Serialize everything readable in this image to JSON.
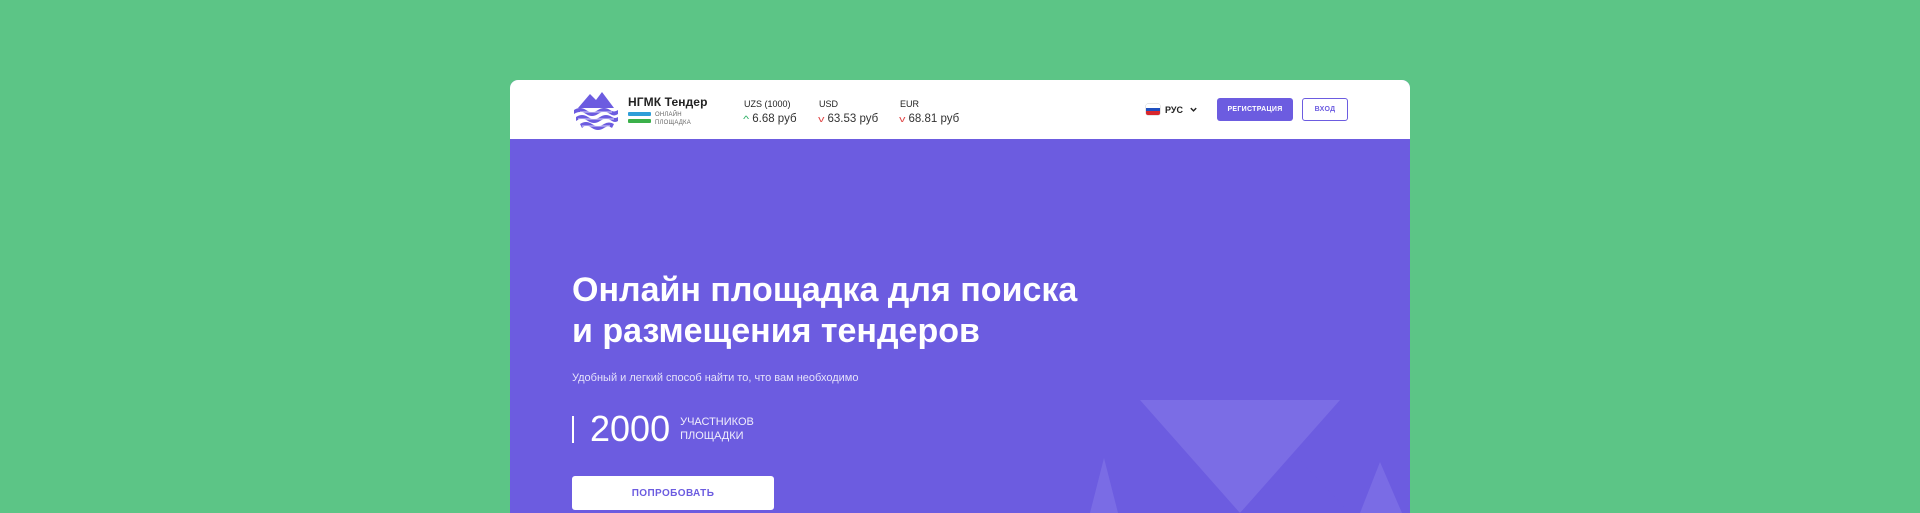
{
  "brand": {
    "title": "НГМК Тендер",
    "subtitle_line1": "ОНЛАЙН",
    "subtitle_line2": "ПЛОЩАДКА",
    "bar_colors": [
      "#2f9ed8",
      "#3bb04a"
    ]
  },
  "rates": [
    {
      "label": "UZS (1000)",
      "value": "6.68 руб",
      "trend": "up"
    },
    {
      "label": "USD",
      "value": "63.53 руб",
      "trend": "down"
    },
    {
      "label": "EUR",
      "value": "68.81 руб",
      "trend": "down"
    }
  ],
  "language": {
    "selected": "РУС",
    "flag_colors": [
      "#ffffff",
      "#1f4fbf",
      "#d8262c"
    ]
  },
  "buttons": {
    "register": "РЕГИСТРАЦИЯ",
    "login": "ВХОД",
    "try": "ПОПРОБОВАТЬ"
  },
  "hero": {
    "title_line1": "Онлайн площадка для поиска",
    "title_line2": "и размещения тендеров",
    "subtitle": "Удобный и легкий способ найти то, что вам необходимо",
    "stat_number": "2000",
    "stat_label_line1": "УЧАСТНИКОВ",
    "stat_label_line2": "ПЛОЩАДКИ"
  },
  "colors": {
    "page_background": "#5cc586",
    "accent": "#6c5ce0",
    "trend_up": "#27ae60",
    "trend_down": "#e04848"
  }
}
